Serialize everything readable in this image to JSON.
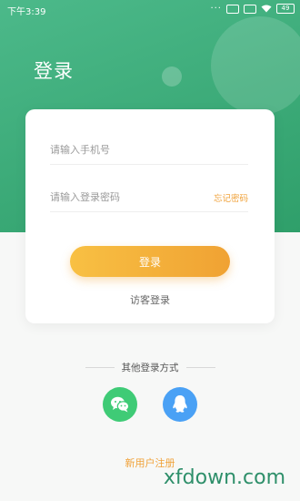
{
  "status_bar": {
    "time": "下午3:39",
    "dots": "···",
    "battery": "49"
  },
  "header": {
    "title": "登录"
  },
  "form": {
    "phone_placeholder": "请输入手机号",
    "password_placeholder": "请输入登录密码",
    "forgot_label": "忘记密码",
    "login_label": "登录",
    "guest_label": "访客登录"
  },
  "other_login": {
    "label": "其他登录方式",
    "providers": [
      "wechat-icon",
      "qq-icon"
    ]
  },
  "register_label": "新用户注册",
  "watermark": "xfdown.com",
  "colors": {
    "header_green": "#3aa979",
    "accent_orange": "#f0a23a",
    "wechat_green": "#3fcb76",
    "qq_blue": "#4aa1f5"
  }
}
